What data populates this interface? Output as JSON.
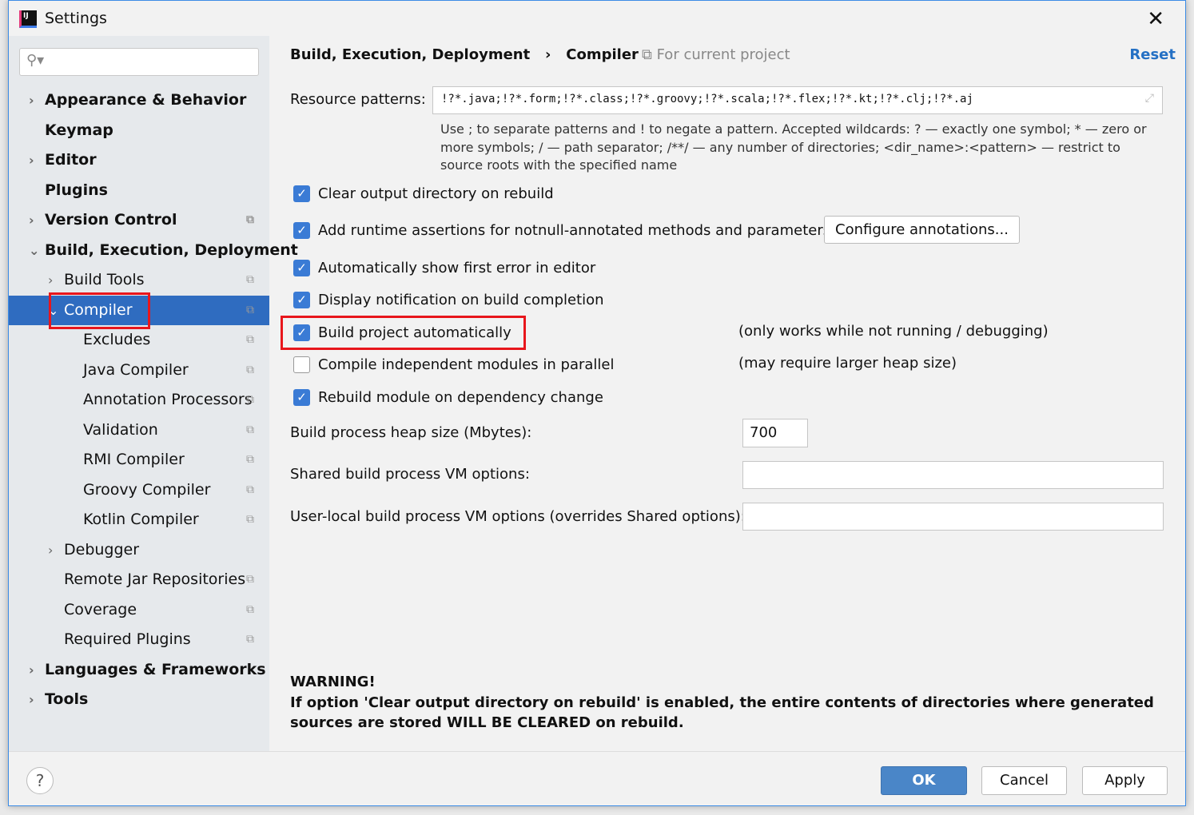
{
  "window": {
    "title": "Settings",
    "close_icon": "close-icon"
  },
  "search": {
    "placeholder": "",
    "icon": "search-icon"
  },
  "sidebar": {
    "items": [
      {
        "label": "Appearance & Behavior",
        "level": 0,
        "bold": true,
        "chevron": "right"
      },
      {
        "label": "Keymap",
        "level": 0,
        "bold": true
      },
      {
        "label": "Editor",
        "level": 0,
        "bold": true,
        "chevron": "right"
      },
      {
        "label": "Plugins",
        "level": 0,
        "bold": true
      },
      {
        "label": "Version Control",
        "level": 0,
        "bold": true,
        "chevron": "right",
        "project": true
      },
      {
        "label": "Build, Execution, Deployment",
        "level": 0,
        "bold": true,
        "chevron": "down"
      },
      {
        "label": "Build Tools",
        "level": 1,
        "chevron": "right",
        "project": true
      },
      {
        "label": "Compiler",
        "level": 1,
        "chevron": "down",
        "project": true,
        "selected": true
      },
      {
        "label": "Excludes",
        "level": 2,
        "project": true
      },
      {
        "label": "Java Compiler",
        "level": 2,
        "project": true
      },
      {
        "label": "Annotation Processors",
        "level": 2,
        "project": true
      },
      {
        "label": "Validation",
        "level": 2,
        "project": true
      },
      {
        "label": "RMI Compiler",
        "level": 2,
        "project": true
      },
      {
        "label": "Groovy Compiler",
        "level": 2,
        "project": true
      },
      {
        "label": "Kotlin Compiler",
        "level": 2,
        "project": true
      },
      {
        "label": "Debugger",
        "level": 1,
        "chevron": "right"
      },
      {
        "label": "Remote Jar Repositories",
        "level": 1,
        "project": true
      },
      {
        "label": "Coverage",
        "level": 1,
        "project": true
      },
      {
        "label": "Required Plugins",
        "level": 1,
        "project": true
      },
      {
        "label": "Languages & Frameworks",
        "level": 0,
        "bold": true,
        "chevron": "right"
      },
      {
        "label": "Tools",
        "level": 0,
        "bold": true,
        "chevron": "right"
      }
    ]
  },
  "header": {
    "breadcrumb": [
      "Build, Execution, Deployment",
      "Compiler"
    ],
    "separator": "›",
    "scope": "For current project",
    "reset": "Reset"
  },
  "resource": {
    "label": "Resource patterns:",
    "value": "!?*.java;!?*.form;!?*.class;!?*.groovy;!?*.scala;!?*.flex;!?*.kt;!?*.clj;!?*.aj",
    "help": "Use ; to separate patterns and ! to negate a pattern. Accepted wildcards: ? — exactly one symbol; * — zero or more symbols; / — path separator; /**/ — any number of directories; <dir_name>:<pattern> — restrict to source roots with the specified name"
  },
  "options": [
    {
      "label": "Clear output directory on rebuild",
      "checked": true
    },
    {
      "label": "Add runtime assertions for notnull-annotated methods and parameters",
      "checked": true
    },
    {
      "label": "Automatically show first error in editor",
      "checked": true
    },
    {
      "label": "Display notification on build completion",
      "checked": true
    },
    {
      "label": "Build project automatically",
      "checked": true,
      "note": "(only works while not running / debugging)"
    },
    {
      "label": "Compile independent modules in parallel",
      "checked": false,
      "note": "(may require larger heap size)"
    },
    {
      "label": "Rebuild module on dependency change",
      "checked": true
    }
  ],
  "configure_button": "Configure annotations...",
  "heap": {
    "label": "Build process heap size (Mbytes):",
    "value": "700"
  },
  "shared_vm": {
    "label": "Shared build process VM options:",
    "value": ""
  },
  "user_vm": {
    "label": "User-local build process VM options (overrides Shared options):",
    "value": ""
  },
  "warning": {
    "title": "WARNING!",
    "text": "If option 'Clear output directory on rebuild' is enabled, the entire contents of directories where generated sources are stored WILL BE CLEARED on rebuild."
  },
  "footer": {
    "help": "?",
    "ok": "OK",
    "cancel": "Cancel",
    "apply": "Apply"
  },
  "colors": {
    "accent": "#2f6cc0",
    "highlight": "#e8161c",
    "link": "#2470c4"
  }
}
